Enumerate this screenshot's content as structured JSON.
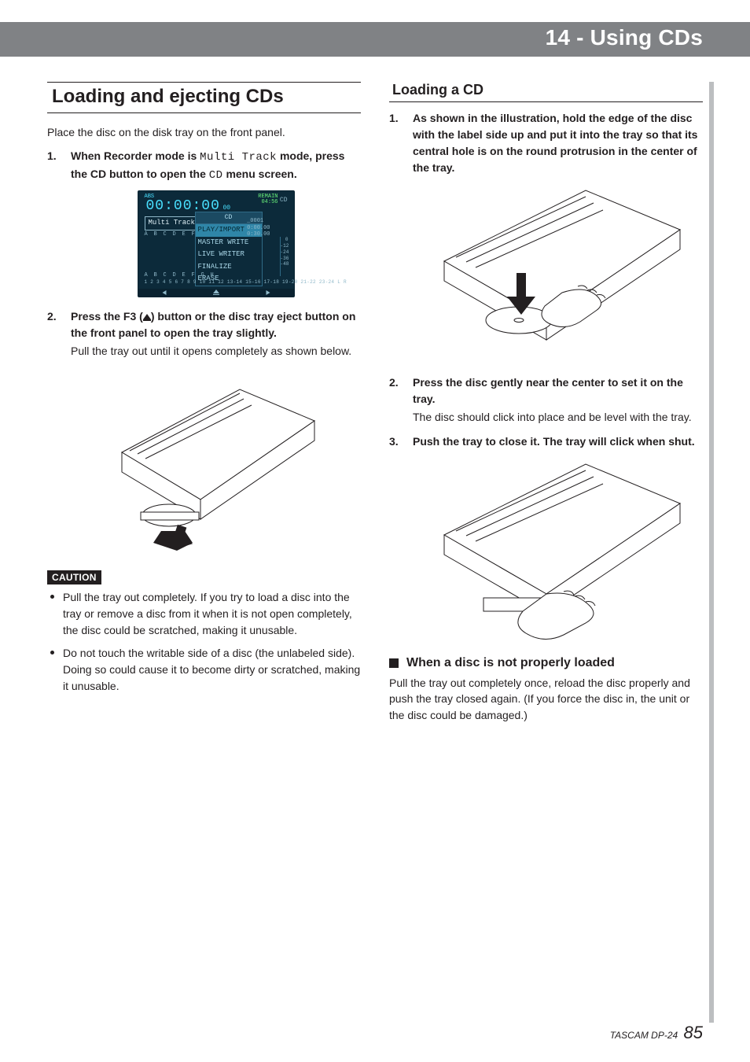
{
  "header": {
    "chapter_title": "14 - Using CDs"
  },
  "left": {
    "section_title": "Loading and ejecting CDs",
    "lead": "Place the disc on the disk tray on the front panel.",
    "steps": [
      {
        "num": "1.",
        "parts": [
          {
            "t": "b",
            "v": "When Recorder mode is "
          },
          {
            "t": "mono",
            "v": "Multi Track"
          },
          {
            "t": "b",
            "v": " mode, press the CD button to open the "
          },
          {
            "t": "mono",
            "v": "CD"
          },
          {
            "t": "b",
            "v": " menu screen."
          }
        ]
      },
      {
        "num": "2.",
        "parts": [
          {
            "t": "b",
            "v": "Press the F3 ("
          },
          {
            "t": "eject"
          },
          {
            "t": "b",
            "v": ") button or the disc tray eject button on the front panel to open the tray slightly."
          }
        ],
        "body": "Pull the tray out until it opens completely as shown below."
      }
    ],
    "caution_label": "CAUTION",
    "cautions": [
      "Pull the tray out completely. If you try to load a disc into the tray or remove a disc from it when it is not open completely, the disc could be scratched, making it unusable.",
      "Do not touch the writable side of a disc (the unlabeled side). Doing so could cause it to become dirty or scratched, making it unusable."
    ],
    "screen": {
      "abs": "ABS",
      "time": "00:00:00",
      "time_sub": "00",
      "remain_label": "REMAIN",
      "remain_value": "04:56",
      "cd_icon": "CD",
      "badge": "Multi Track",
      "channels_top": "A B C D E F G H",
      "menu_title": "CD",
      "menu_items": [
        "PLAY/IMPORT",
        "MASTER WRITE",
        "LIVE WRITER",
        "FINALIZE",
        "ERASE"
      ],
      "menu_selected_index": 0,
      "right_panel": [
        "_0001",
        "0:00.00",
        "0:30.00"
      ],
      "meter_marks": [
        "0",
        "-12",
        "-24",
        "-36",
        "-48"
      ],
      "channels_bottom_labels": "A B C D E F G H",
      "channels_bottom_nums": "1  2  3  4  5  6  7  8  9 10 11 12 13-14 15-16 17-18 19-20 21-22 23-24    L R"
    }
  },
  "right": {
    "section_title": "Loading a CD",
    "steps": [
      {
        "num": "1.",
        "parts": [
          {
            "t": "b",
            "v": "As shown in the illustration, hold the edge of the disc with the label side up and put it into the tray so that its central hole is on the round protrusion in the center of the tray."
          }
        ]
      },
      {
        "num": "2.",
        "parts": [
          {
            "t": "b",
            "v": "Press the disc gently near the center to set it on the tray."
          }
        ],
        "body": "The disc should click into place and be level with the tray."
      },
      {
        "num": "3.",
        "parts": [
          {
            "t": "b",
            "v": "Push the tray to close it. The tray will click when shut."
          }
        ]
      }
    ],
    "subhead": "When a disc is not properly loaded",
    "subbody": "Pull the tray out completely once, reload the disc properly and push the tray closed again. (If you force the disc in, the unit or the disc could be damaged.)"
  },
  "footer": {
    "product": "TASCAM DP-24",
    "page": "85"
  }
}
